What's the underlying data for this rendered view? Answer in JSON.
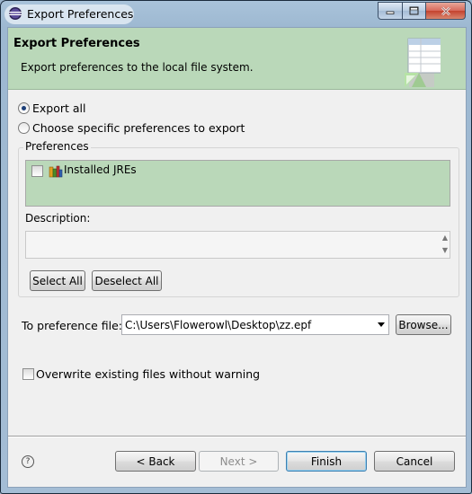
{
  "window": {
    "title": "Export Preferences",
    "minimize_icon": "minimize-icon",
    "maximize_icon": "maximize-icon",
    "close_icon": "close-icon"
  },
  "banner": {
    "title": "Export Preferences",
    "description": "Export preferences to the local file system."
  },
  "options": {
    "export_all_label": "Export all",
    "export_all_selected": true,
    "choose_specific_label": "Choose specific preferences to export",
    "choose_specific_selected": false
  },
  "preferences": {
    "group_label": "Preferences",
    "items": [
      {
        "label": "Installed JREs",
        "checked": false,
        "icon": "jre-icon"
      }
    ],
    "description_label": "Description:",
    "description_value": "",
    "select_all_label": "Select All",
    "deselect_all_label": "Deselect All"
  },
  "file": {
    "label": "To preference file:",
    "value": "C:\\Users\\Flowerowl\\Desktop\\zz.epf",
    "browse_label": "Browse..."
  },
  "overwrite": {
    "label": "Overwrite existing files without warning",
    "checked": false
  },
  "footer": {
    "help_icon": "help-icon",
    "back_label": "< Back",
    "next_label": "Next >",
    "finish_label": "Finish",
    "cancel_label": "Cancel"
  },
  "colors": {
    "banner_bg": "#bad8b9",
    "list_bg": "#bad8b9",
    "frame": "#a4bdd5"
  }
}
